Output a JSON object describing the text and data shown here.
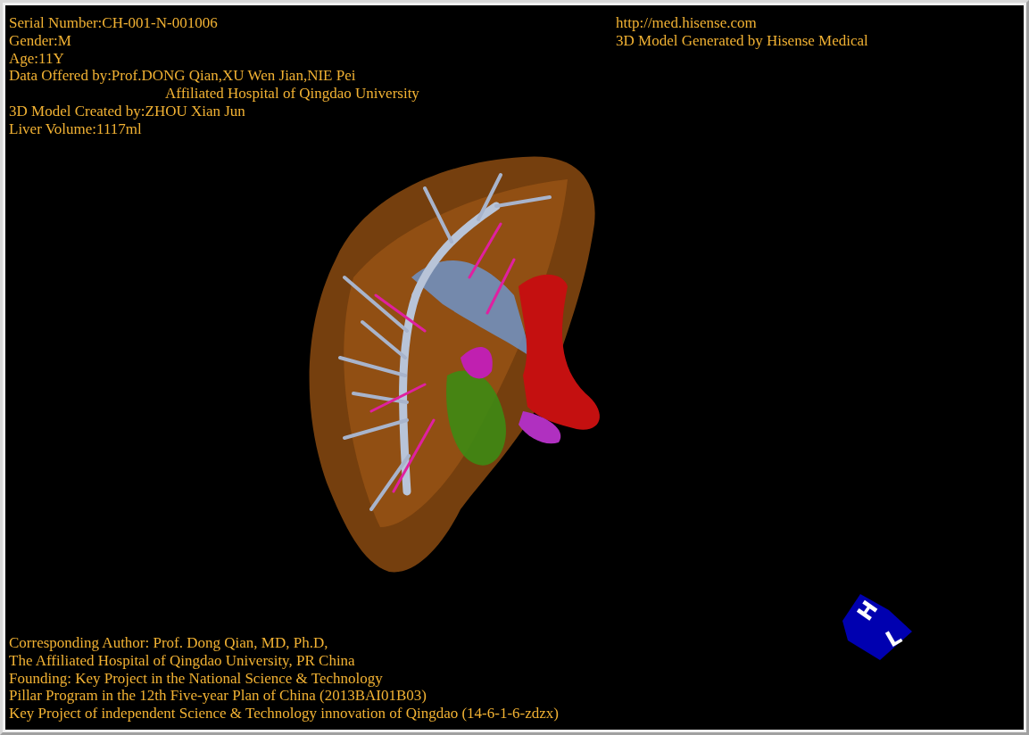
{
  "patient_info": [
    {
      "text": "Serial Number:CH-001-N-001006"
    },
    {
      "text": "Gender:M"
    },
    {
      "text": "Age:11Y"
    },
    {
      "text": "Data Offered by:Prof.DONG Qian,XU Wen Jian,NIE Pei",
      "continuation": "Affiliated Hospital of Qingdao University"
    },
    {
      "text": "3D Model Created by:ZHOU Xian Jun"
    },
    {
      "text": "Liver Volume:1117ml"
    }
  ],
  "source_info": [
    "http://med.hisense.com",
    "3D Model Generated by Hisense Medical"
  ],
  "orientation_cube": {
    "labels": [
      "H",
      "L"
    ]
  },
  "credits": [
    "Corresponding Author: Prof. Dong Qian, MD, Ph.D,",
    "The Affiliated Hospital of Qingdao University, PR China",
    "Founding: Key Project in the National Science & Technology",
    "Pillar Program in the 12th Five-year Plan of China (2013BAI01B03)",
    "Key Project of independent Science & Technology innovation of Qingdao (14-6-1-6-zdzx)"
  ]
}
